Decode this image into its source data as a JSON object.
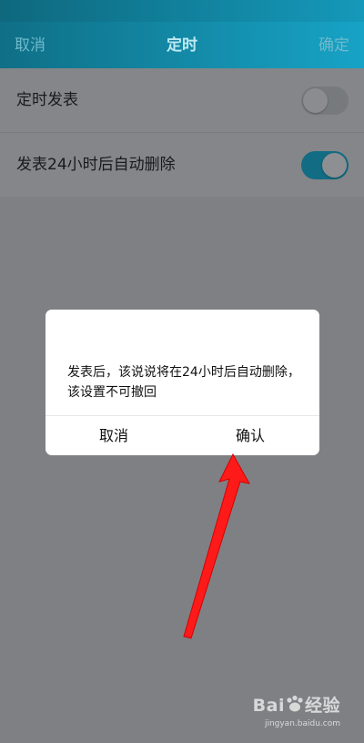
{
  "header": {
    "left_label": "取消",
    "title": "定时",
    "right_label": "确定"
  },
  "settings": {
    "items": [
      {
        "label": "定时发表",
        "toggle": "off"
      },
      {
        "label": "发表24小时后自动删除",
        "toggle": "on"
      }
    ]
  },
  "dialog": {
    "message": "发表后，该说说将在24小时后自动删除，该设置不可撤回",
    "cancel_label": "取消",
    "confirm_label": "确认"
  },
  "watermark": {
    "brand": "Bai",
    "brand_tail": "经验",
    "url": "jingyan.baidu.com"
  },
  "colors": {
    "header_start": "#0f6f86",
    "header_end": "#17a3c6",
    "toggle_on": "#126c83",
    "overlay": "#7f8084",
    "arrow": "#ff1a1a"
  }
}
